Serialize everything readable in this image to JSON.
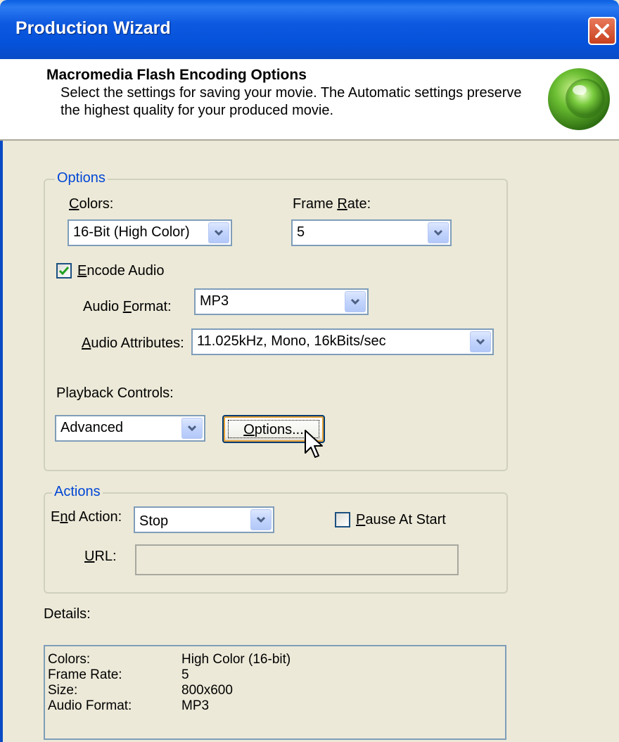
{
  "window": {
    "title": "Production Wizard"
  },
  "header": {
    "title": "Macromedia Flash Encoding Options",
    "description": "Select the settings for saving your movie.  The Automatic settings preserve the highest quality for your produced movie."
  },
  "options_group": {
    "label": "Options",
    "colors": {
      "label_u": "C",
      "label_rest": "olors:",
      "value": "16-Bit (High Color)"
    },
    "frame_rate": {
      "label_pre": "Frame ",
      "label_u": "R",
      "label_rest": "ate:",
      "value": "5"
    },
    "encode_audio": {
      "label_u": "E",
      "label_rest": "ncode Audio",
      "checked": true
    },
    "audio_format": {
      "label_pre": "Audio ",
      "label_u": "F",
      "label_rest": "ormat:",
      "value": "MP3"
    },
    "audio_attributes": {
      "label_u": "A",
      "label_rest": "udio Attributes:",
      "value": "11.025kHz, Mono, 16kBits/sec"
    },
    "playback_controls": {
      "label": "Playback Controls:",
      "value": "Advanced",
      "options_button_u": "O",
      "options_button_rest": "ptions..."
    }
  },
  "actions_group": {
    "label": "Actions",
    "end_action": {
      "label_pre": "E",
      "label_u": "n",
      "label_rest": "d Action:",
      "value": "Stop"
    },
    "pause_at_start": {
      "label_u": "P",
      "label_rest": "ause At Start",
      "checked": false
    },
    "url": {
      "label_u": "U",
      "label_rest": "RL:",
      "value": ""
    }
  },
  "details": {
    "label": "Details:",
    "rows": [
      {
        "key": "Colors:",
        "value": "High Color (16-bit)"
      },
      {
        "key": "Frame Rate:",
        "value": "5"
      },
      {
        "key": "Size:",
        "value": "800x600"
      },
      {
        "key": "Audio Format:",
        "value": "MP3"
      }
    ]
  },
  "colors": {
    "titlebar": "#0552DA",
    "group_label": "#0046D5",
    "dialog_bg": "#ECE9D8",
    "logo_green": "#4FA52A"
  }
}
